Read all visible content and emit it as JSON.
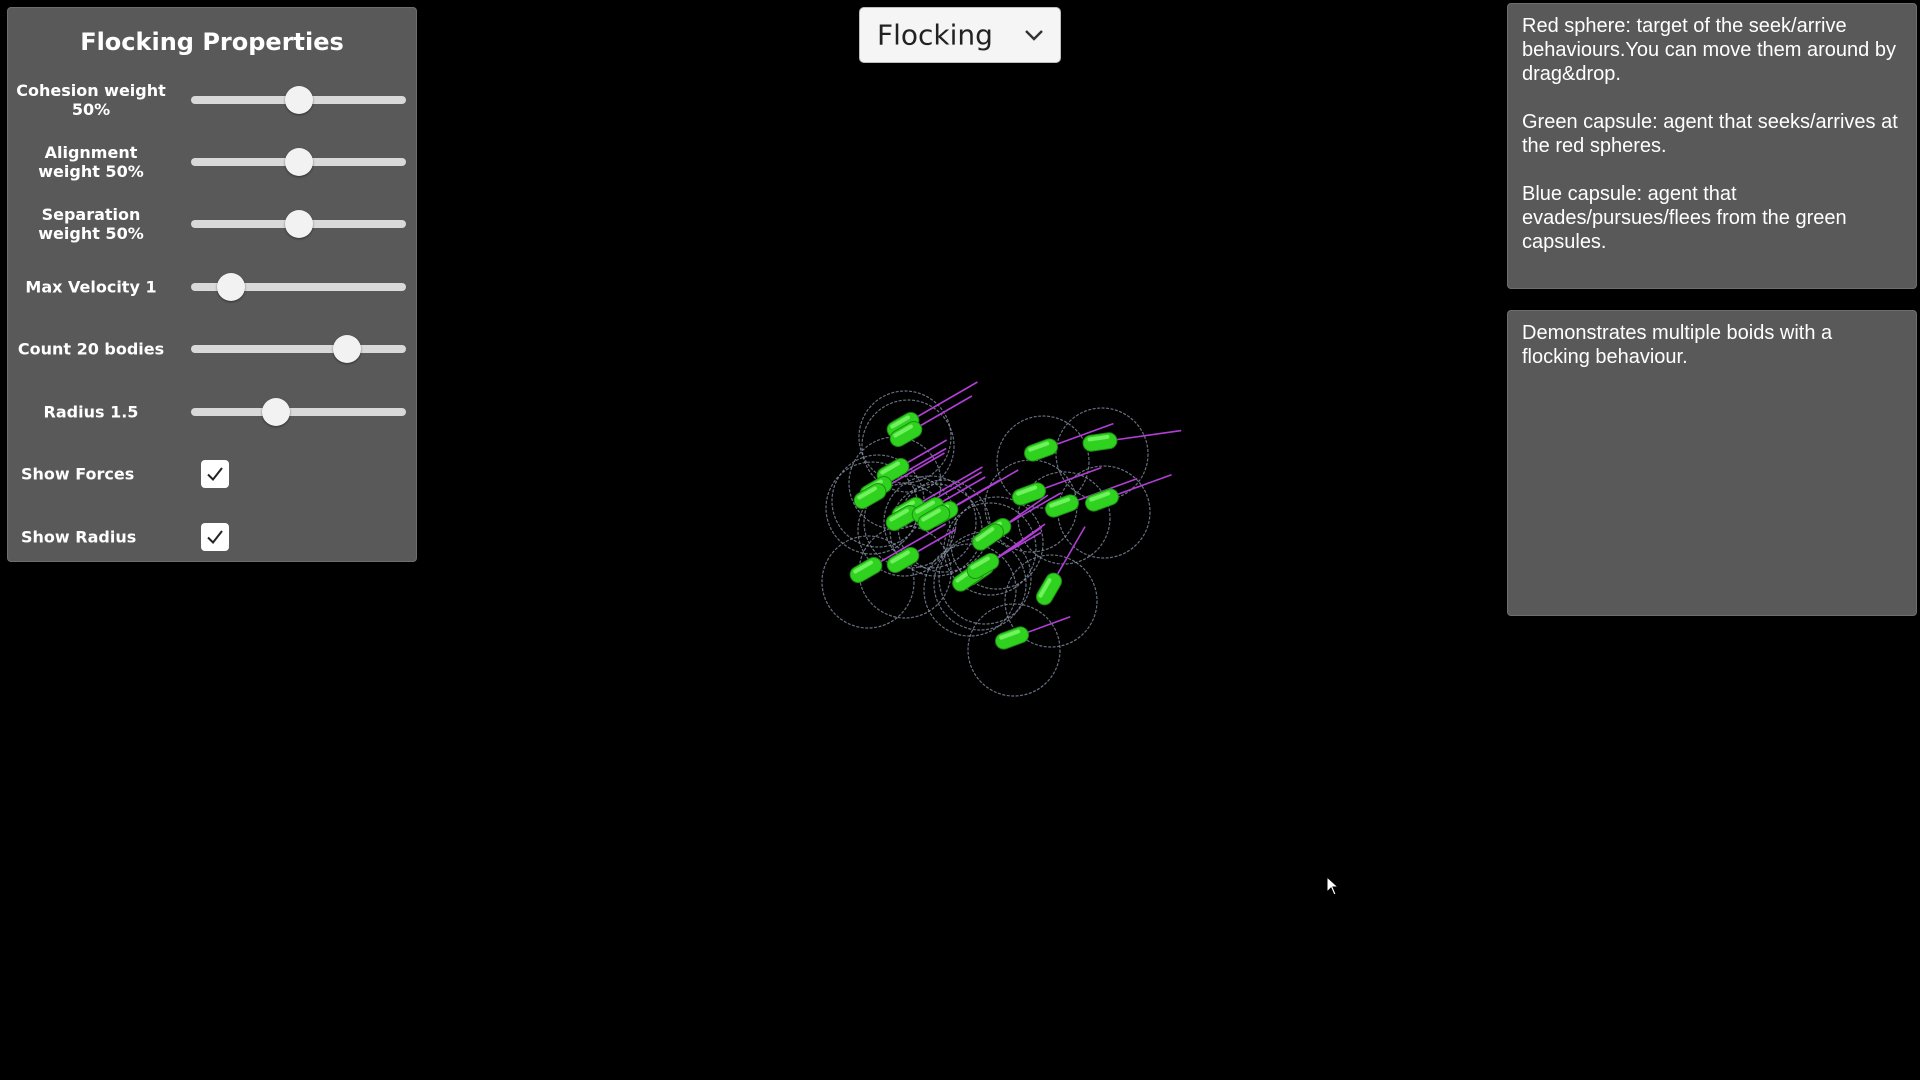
{
  "flocking_panel": {
    "title": "Flocking Properties",
    "sliders": [
      {
        "label": "Cohesion weight 50%",
        "value": 0.5
      },
      {
        "label": "Alignment weight 50%",
        "value": 0.5
      },
      {
        "label": "Separation weight 50%",
        "value": 0.5
      },
      {
        "label": "Max Velocity 1",
        "value": 0.14
      },
      {
        "label": "Count 20 bodies",
        "value": 0.76
      },
      {
        "label": "Radius 1.5",
        "value": 0.38
      }
    ],
    "checkboxes": [
      {
        "label": "Show Forces",
        "checked": true
      },
      {
        "label": "Show Radius",
        "checked": true
      }
    ]
  },
  "mode_dropdown": {
    "selected": "Flocking",
    "icon": "chevron-down-icon"
  },
  "legend_panel": {
    "paragraphs": [
      "Red sphere: target of the seek/arrive behaviours.You can move them around by drag&drop.",
      "Green capsule: agent that seeks/arrives at the red spheres.",
      "Blue capsule: agent that evades/pursues/flees from the green capsules."
    ]
  },
  "description_panel": {
    "text": "Demonstrates multiple boids with a flocking behaviour."
  },
  "colors": {
    "background": "#000000",
    "panel": "#595959",
    "agent": "#2fd31f",
    "force_line": "#b13fd6",
    "radius_circle": "#8a96a8"
  }
}
